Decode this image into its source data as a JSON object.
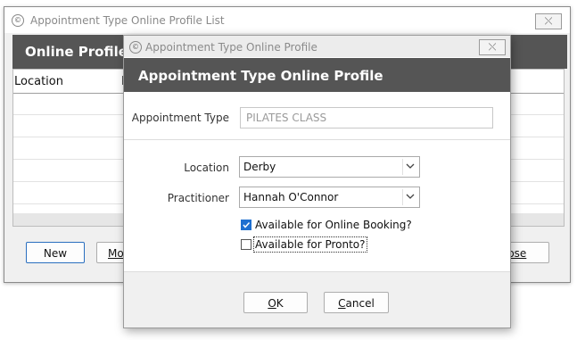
{
  "list_window": {
    "title": "Appointment Type Online Profile List",
    "close_glyph": "⤬",
    "header": "Online Profile",
    "columns": [
      "Location",
      "I"
    ],
    "buttons": {
      "new": "New",
      "modify_partial": "Mo",
      "close_partial": "lose",
      "close_mnemonic": "C"
    }
  },
  "dialog": {
    "title": "Appointment Type Online Profile",
    "close_glyph": "⤬",
    "header": "Appointment Type Online Profile",
    "appointment_type": {
      "label": "Appointment Type",
      "value": "PILATES CLASS"
    },
    "location": {
      "label": "Location",
      "value": "Derby"
    },
    "practitioner": {
      "label": "Practitioner",
      "value": "Hannah O'Connor"
    },
    "online_booking": {
      "label": "Available for Online Booking?",
      "checked": true
    },
    "pronto": {
      "label": "Available for Pronto?",
      "checked": false
    },
    "ok_label": "OK",
    "ok_mnemonic": "O",
    "ok_rest": "K",
    "cancel_label": "Cancel",
    "cancel_mnemonic": "C",
    "cancel_rest": "ancel"
  },
  "icons": {
    "app": "app-logo-icon",
    "dropdown": "chevron-down-icon",
    "close": "close-icon",
    "check": "checkmark-icon"
  },
  "colors": {
    "header_band": "#555555",
    "accent": "#1e6fd0"
  }
}
